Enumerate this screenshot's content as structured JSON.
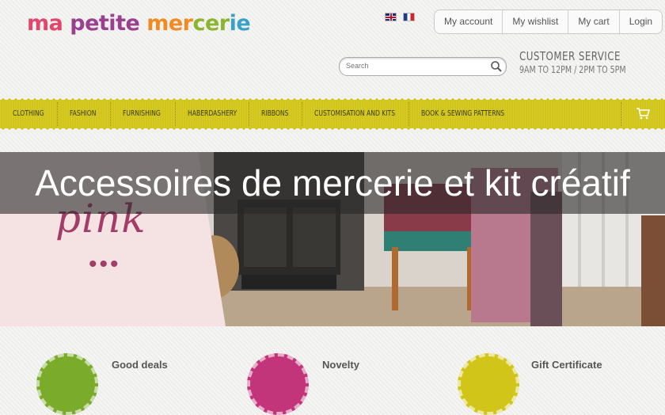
{
  "logo": {
    "text_parts": [
      "ma ",
      "petite ",
      "mer",
      "cer",
      "ie"
    ]
  },
  "languages": [
    {
      "name": "english-flag"
    },
    {
      "name": "french-flag"
    }
  ],
  "account_nav": [
    "My account",
    "My wishlist",
    "My cart",
    "Login"
  ],
  "search": {
    "placeholder": "Search",
    "icon": "magnifier-icon"
  },
  "customer_service": {
    "title": "CUSTOMER SERVICE",
    "hours": "9AM TO 12PM / 2PM TO 5PM"
  },
  "main_nav": [
    "CLOTHING",
    "FASHION",
    "FURNISHING",
    "HABERDASHERY",
    "RIBBONS",
    "CUSTOMISATION AND KITS",
    "BOOK & SEWING PATTERNS"
  ],
  "cart_icon": "shopping-cart-icon",
  "hero": {
    "word": "pink",
    "dots": "•••"
  },
  "banner": {
    "text": "Accessoires de mercerie et kit créatif"
  },
  "features": [
    "Good deals",
    "Novelty",
    "Gift Certificate"
  ],
  "colors": {
    "nav_bg": "#d2c51a",
    "hero_pink": "#f5e3e4",
    "hero_text": "#a23c68",
    "badge_green": "#7aab2a",
    "badge_magenta": "#c2357a",
    "badge_yellow": "#d2c51a"
  }
}
